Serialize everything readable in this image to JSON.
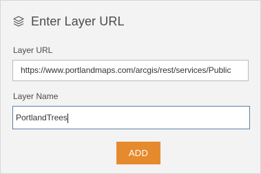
{
  "header": {
    "title": "Enter Layer URL",
    "icon": "layers-icon"
  },
  "url_field": {
    "label": "Layer URL",
    "value": "https://www.portlandmaps.com/arcgis/rest/services/Public"
  },
  "name_field": {
    "label": "Layer Name",
    "value": "PortlandTrees"
  },
  "add_button": {
    "label": "ADD",
    "color": "#e68a2e"
  }
}
